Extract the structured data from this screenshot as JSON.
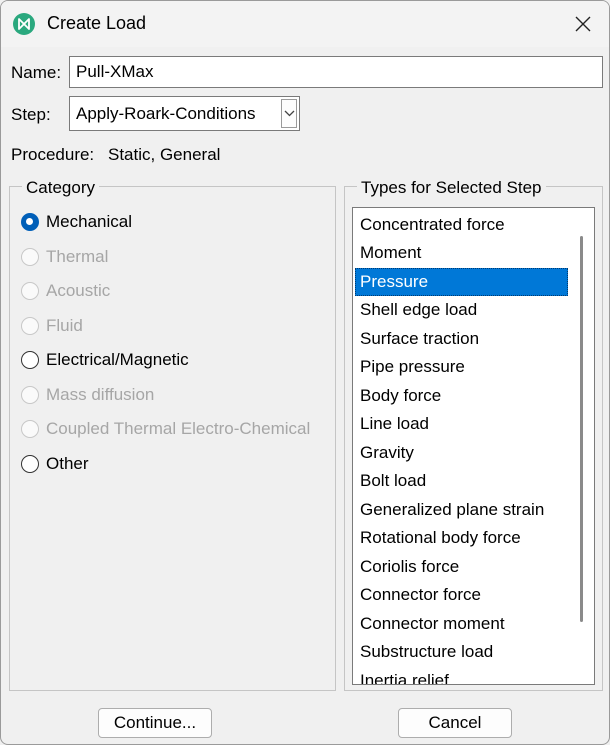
{
  "window": {
    "title": "Create Load",
    "close_icon": "close-icon",
    "app_icon": "abaqus-logo-icon",
    "accent_color": "#0078d7"
  },
  "name_field": {
    "label": "Name:",
    "value": "Pull-XMax"
  },
  "step_field": {
    "label": "Step:",
    "value": "Apply-Roark-Conditions"
  },
  "procedure": {
    "label": "Procedure:",
    "value": "Static, General"
  },
  "category": {
    "title": "Category",
    "options": [
      {
        "label": "Mechanical",
        "selected": true,
        "enabled": true
      },
      {
        "label": "Thermal",
        "selected": false,
        "enabled": false
      },
      {
        "label": "Acoustic",
        "selected": false,
        "enabled": false
      },
      {
        "label": "Fluid",
        "selected": false,
        "enabled": false
      },
      {
        "label": "Electrical/Magnetic",
        "selected": false,
        "enabled": true
      },
      {
        "label": "Mass diffusion",
        "selected": false,
        "enabled": false
      },
      {
        "label": "Coupled Thermal Electro-Chemical",
        "selected": false,
        "enabled": false
      },
      {
        "label": "Other",
        "selected": false,
        "enabled": true
      }
    ]
  },
  "types": {
    "title": "Types for Selected Step",
    "selected": "Pressure",
    "items": [
      "Concentrated force",
      "Moment",
      "Pressure",
      "Shell edge load",
      "Surface traction",
      "Pipe pressure",
      "Body force",
      "Line load",
      "Gravity",
      "Bolt load",
      "Generalized plane strain",
      "Rotational body force",
      "Coriolis force",
      "Connector force",
      "Connector moment",
      "Substructure load",
      "Inertia relief"
    ]
  },
  "buttons": {
    "continue": "Continue...",
    "cancel": "Cancel"
  }
}
